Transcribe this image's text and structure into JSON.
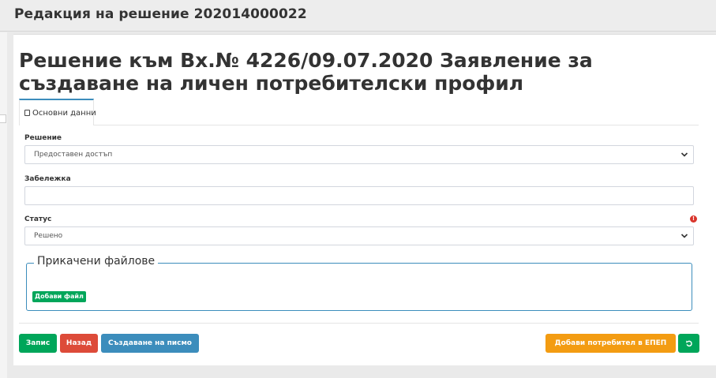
{
  "header": {
    "title": "Редакция на решение 202014000022"
  },
  "page": {
    "heading": "Решение към Вх.№ 4226/09.07.2020 Заявление за създаване на личен потребителски профил"
  },
  "tabs": [
    {
      "label": "Основни данни",
      "icon": "database-icon"
    }
  ],
  "form": {
    "decision_label": "Решение",
    "decision_value": "Предоставен достъп",
    "note_label": "Забележка",
    "note_value": "",
    "status_label": "Статус",
    "status_value": "Решено",
    "status_required_mark": "!"
  },
  "attachments": {
    "legend": "Прикачени файлове",
    "add_label": "Добави файл"
  },
  "actions": {
    "save": "Запис",
    "back": "Назад",
    "create_letter": "Създаване на писмо",
    "add_user": "Добави потребител в ЕПЕП",
    "undo_icon": "undo-icon"
  },
  "colors": {
    "green": "#00a65a",
    "red": "#dd4b39",
    "blue": "#3c8dbc",
    "orange": "#f39c12"
  }
}
